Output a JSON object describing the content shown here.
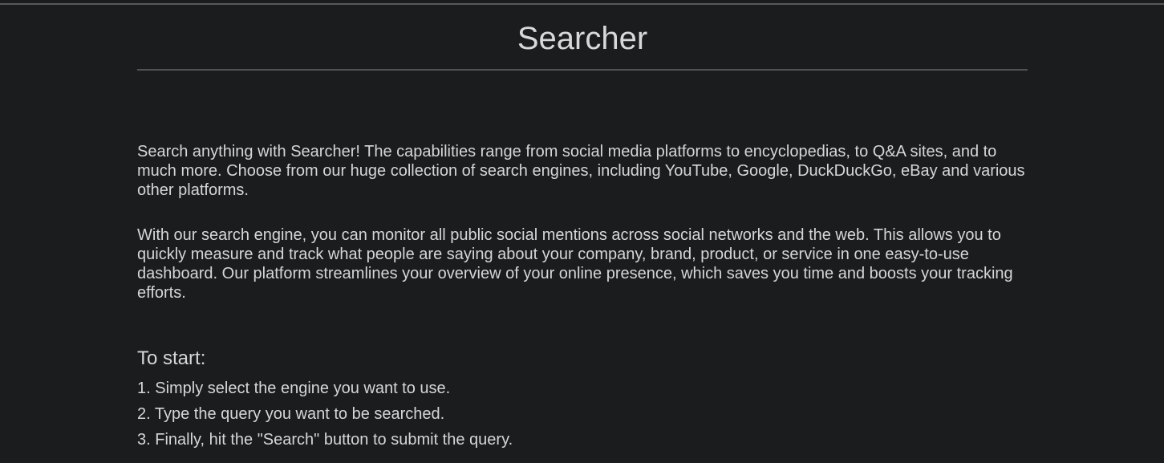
{
  "header": {
    "title": "Searcher"
  },
  "content": {
    "paragraph1": "Search anything with Searcher! The capabilities range from social media platforms to encyclopedias, to Q&A sites, and to much more. Choose from our huge collection of search engines, including YouTube, Google, DuckDuckGo, eBay and various other platforms.",
    "paragraph2": "With our search engine, you can monitor all public social mentions across social networks and the web. This allows you to quickly measure and track what people are saying about your company, brand, product, or service in one easy-to-use dashboard. Our platform streamlines your overview of your online presence, which saves you time and boosts your tracking efforts.",
    "start_heading": "To start:",
    "steps": [
      "1. Simply select the engine you want to use.",
      "2. Type the query you want to be searched.",
      "3. Finally, hit the \"Search\" button to submit the query."
    ]
  },
  "colors": {
    "background": "#1b1c1e",
    "text": "#d6d6d6",
    "divider": "#4f5155"
  }
}
